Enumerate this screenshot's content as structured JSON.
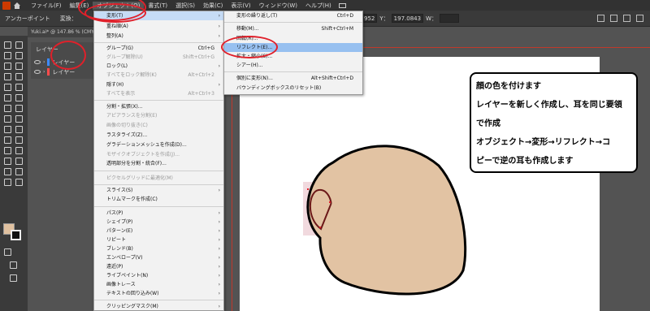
{
  "menubar": {
    "items": [
      "ファイル(F)",
      "編集(E)",
      "オブジェクト(O)",
      "書式(T)",
      "選択(S)",
      "効果(C)",
      "表示(V)",
      "ウィンドウ(W)",
      "ヘルプ(H)"
    ]
  },
  "controlbar": {
    "left_label": "アンカーポイント",
    "convert_label": "変換：",
    "x_value": "952",
    "y_label": "Y：",
    "y_value": "197.0843",
    "w_label": "W："
  },
  "tab": {
    "title": "Yuki.ai* @ 147.86 % (CMYK"
  },
  "layers": {
    "title": "レイヤー",
    "rows": [
      {
        "name": "レイヤー",
        "color": "#3c8aff"
      },
      {
        "name": "レイヤー",
        "color": "#ff4b4b"
      }
    ]
  },
  "object_menu": {
    "items": [
      {
        "label": "変形(T)",
        "arrow": "›"
      },
      {
        "label": "重ね順(A)",
        "arrow": "›"
      },
      {
        "label": "整列(A)",
        "arrow": "›"
      },
      {
        "label": "グループ(G)",
        "shortcut": "Ctrl+G"
      },
      {
        "label": "グループ解除(U)",
        "shortcut": "Shift+Ctrl+G"
      },
      {
        "label": "ロック(L)",
        "arrow": "›"
      },
      {
        "label": "すべてをロック解除(K)",
        "shortcut": "Alt+Ctrl+2"
      },
      {
        "label": "隠す(H)",
        "arrow": "›"
      },
      {
        "label": "すべてを表示",
        "shortcut": "Alt+Ctrl+3"
      },
      {
        "label": "分割・拡張(X)..."
      },
      {
        "label": "アピアランスを分割(E)"
      },
      {
        "label": "画像の切り抜き(C)"
      },
      {
        "label": "ラスタライズ(Z)..."
      },
      {
        "label": "グラデーションメッシュを作成(D)..."
      },
      {
        "label": "モザイクオブジェクトを作成(J)..."
      },
      {
        "label": "透明部分を分割・統合(F)..."
      },
      {
        "label": "ピクセルグリッドに最適化(M)"
      },
      {
        "label": "スライス(S)",
        "arrow": "›"
      },
      {
        "label": "トリムマークを作成(C)"
      },
      {
        "label": "パス(P)",
        "arrow": "›"
      },
      {
        "label": "シェイプ(P)",
        "arrow": "›"
      },
      {
        "label": "パターン(E)",
        "arrow": "›"
      },
      {
        "label": "リピート",
        "arrow": "›"
      },
      {
        "label": "ブレンド(B)",
        "arrow": "›"
      },
      {
        "label": "エンベロープ(V)",
        "arrow": "›"
      },
      {
        "label": "遠近(P)",
        "arrow": "›"
      },
      {
        "label": "ライブペイント(N)",
        "arrow": "›"
      },
      {
        "label": "画像トレース",
        "arrow": "›"
      },
      {
        "label": "テキストの回り込み(W)",
        "arrow": "›"
      },
      {
        "label": "クリッピングマスク(M)",
        "arrow": "›"
      }
    ]
  },
  "transform_menu": {
    "items": [
      {
        "label": "変形の繰り返し(T)",
        "shortcut": "Ctrl+D"
      },
      {
        "label": "移動(M)...",
        "shortcut": "Shift+Ctrl+M"
      },
      {
        "label": "回転(R)..."
      },
      {
        "label": "リフレクト(E)..."
      },
      {
        "label": "拡大・縮小(S)..."
      },
      {
        "label": "シアー(H)..."
      },
      {
        "label": "個別に変形(N)...",
        "shortcut": "Alt+Shift+Ctrl+D"
      },
      {
        "label": "バウンディングボックスのリセット(B)"
      }
    ]
  },
  "note": {
    "lines": [
      "顔の色を付けます",
      "レイヤーを新しく作成し、耳を同じ要領",
      "で作成",
      "オブジェクト→変形→リフレクト→コ",
      "ピーで逆の耳も作成します"
    ]
  },
  "colors": {
    "face_fill": "#e2c3a3",
    "annotation_red": "#e0202a",
    "menu_highlight": "#97c0f0"
  }
}
